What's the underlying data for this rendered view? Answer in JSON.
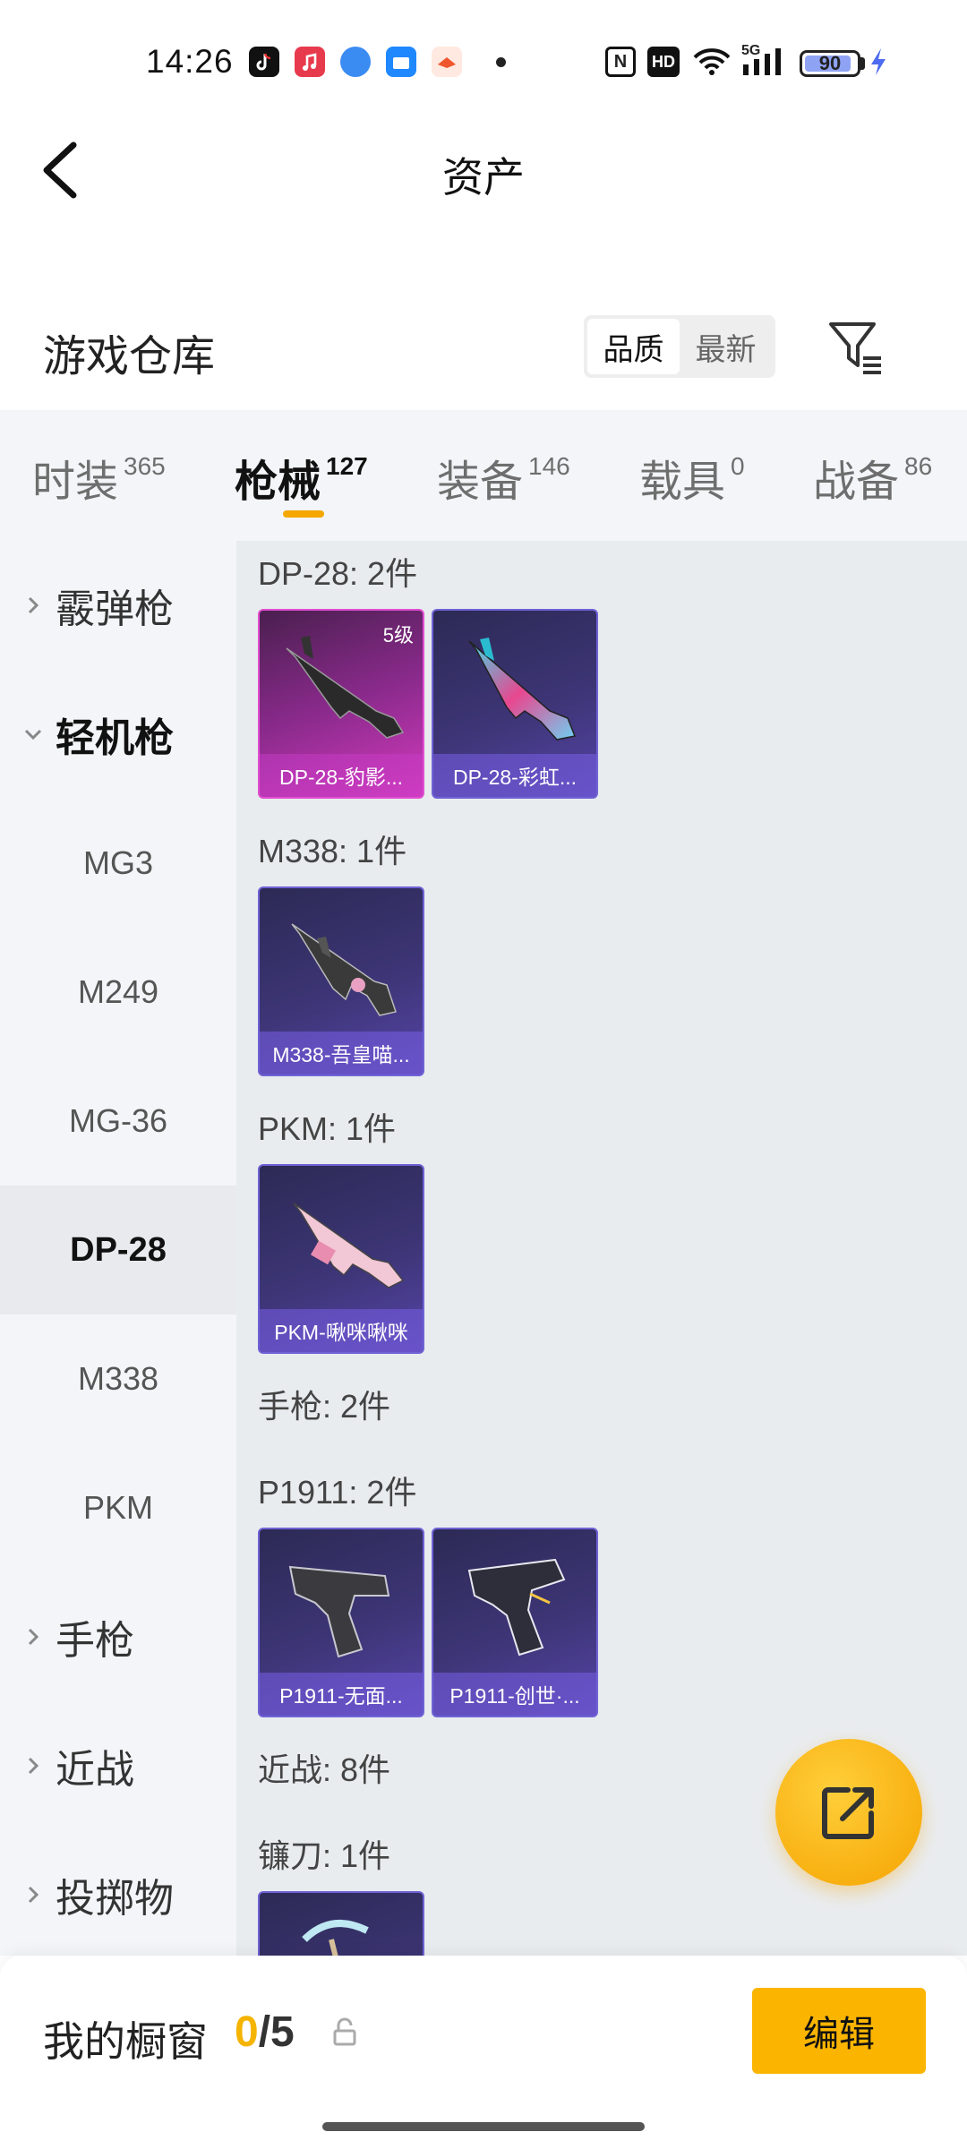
{
  "status_bar": {
    "time": "14:26",
    "nfc": "N",
    "hd": "HD",
    "network": "5G",
    "battery": "90",
    "app_icons": [
      "tiktok-icon",
      "music-icon",
      "app-blue-icon",
      "app-store-icon",
      "game-icon"
    ]
  },
  "header": {
    "title": "资产"
  },
  "warehouse": {
    "title": "游戏仓库",
    "sort_options": [
      "品质",
      "最新"
    ],
    "sort_active": "品质"
  },
  "category_tabs": [
    {
      "label": "时装",
      "count": "365"
    },
    {
      "label": "枪械",
      "count": "127"
    },
    {
      "label": "装备",
      "count": "146"
    },
    {
      "label": "载具",
      "count": "0"
    },
    {
      "label": "战备",
      "count": "86"
    }
  ],
  "active_category": "枪械",
  "side_nav": {
    "groups": [
      {
        "label": "霰弹枪",
        "expanded": false
      },
      {
        "label": "轻机枪",
        "expanded": true
      },
      {
        "label": "手枪",
        "expanded": false
      },
      {
        "label": "近战",
        "expanded": false
      },
      {
        "label": "投掷物",
        "expanded": false
      }
    ],
    "subitems": [
      "MG3",
      "M249",
      "MG-36",
      "DP-28",
      "M338",
      "PKM"
    ],
    "active_subitem": "DP-28"
  },
  "content": {
    "sections": [
      {
        "label": "DP-28: 2件"
      },
      {
        "label": "M338: 1件"
      },
      {
        "label": "PKM: 1件"
      },
      {
        "label": "手枪: 2件"
      },
      {
        "label": "P1911: 2件"
      },
      {
        "label": "近战: 8件"
      },
      {
        "label": "镰刀: 1件"
      }
    ],
    "items": [
      {
        "name": "DP-28-豹影...",
        "level": "5级",
        "style": "pink"
      },
      {
        "name": "DP-28-彩虹...",
        "style": "purple"
      },
      {
        "name": "M338-吾皇喵...",
        "style": "purple"
      },
      {
        "name": "PKM-啾咪啾咪",
        "style": "purple"
      },
      {
        "name": "P1911-无面...",
        "style": "purple"
      },
      {
        "name": "P1911-创世·...",
        "style": "purple"
      }
    ]
  },
  "bottom_bar": {
    "showcase_label": "我的橱窗",
    "count_current": "0",
    "count_total": "/5",
    "edit_label": "编辑"
  },
  "colors": {
    "accent": "#f5a700",
    "edit_button": "#fbb500",
    "fab": "#f5a300"
  }
}
